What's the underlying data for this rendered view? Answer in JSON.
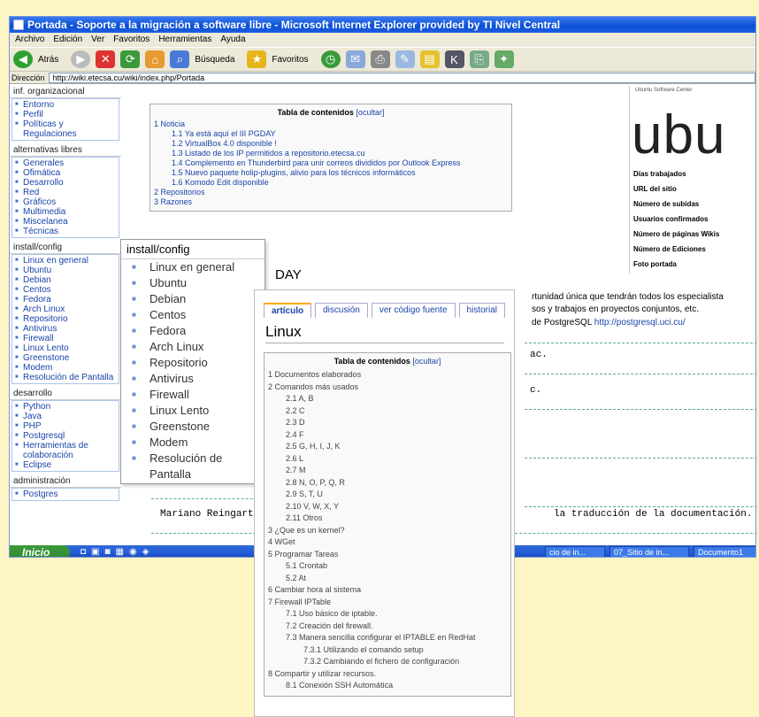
{
  "window": {
    "title": "Portada - Soporte a la migración a software libre - Microsoft Internet Explorer provided by TI Nivel Central"
  },
  "menu": [
    "Archivo",
    "Edición",
    "Ver",
    "Favoritos",
    "Herramientas",
    "Ayuda"
  ],
  "toolbar": {
    "back": "Atrás",
    "search": "Búsqueda",
    "favorites": "Favoritos"
  },
  "address": {
    "label": "Dirección",
    "url": "http://wiki.etecsa.cu/wiki/index.php/Portada"
  },
  "nav": [
    {
      "title": "inf. organizacional",
      "items": [
        "Entorno",
        "Perfil",
        "Políticas y Regulaciones"
      ]
    },
    {
      "title": "alternativas libres",
      "items": [
        "Generales",
        "Ofimática",
        "Desarrollo",
        "Red",
        "Gráficos",
        "Multimedia",
        "Miscelanea",
        "Técnicas"
      ]
    },
    {
      "title": "install/config",
      "items": [
        "Linux en general",
        "Ubuntu",
        "Debian",
        "Centos",
        "Fedora",
        "Arch Linux",
        "Repositorio",
        "Antivirus",
        "Firewall",
        "Linux Lento",
        "Greenstone",
        "Modem",
        "Resolución de Pantalla"
      ]
    },
    {
      "title": "desarrollo",
      "items": [
        "Python",
        "Java",
        "PHP",
        "Postgresql",
        "Herramientas de colaboración",
        "Eclipse"
      ]
    },
    {
      "title": "administración",
      "items": [
        "Postgres"
      ]
    }
  ],
  "toc1": {
    "title": "Tabla de contenidos",
    "toggle": "[ocultar]",
    "entries": [
      {
        "t": "1 Noticia",
        "l": 1
      },
      {
        "t": "1.1 Ya está aquí el III PGDAY",
        "l": 2
      },
      {
        "t": "1.2 VirtualBox 4.0 disponible !",
        "l": 2
      },
      {
        "t": "1.3 Listado de los IP permitidos a repositorio.etecsa.cu",
        "l": 2
      },
      {
        "t": "1.4 Complemento en Thunderbird para unir correos divididos por Outlook Express",
        "l": 2
      },
      {
        "t": "1.5 Nuevo paquete holip-plugins, alivio para los técnicos informáticos",
        "l": 2
      },
      {
        "t": "1.6 Komodo Edit disponible",
        "l": 2
      },
      {
        "t": "2 Repositorios",
        "l": 1
      },
      {
        "t": "3 Razones",
        "l": 1
      }
    ]
  },
  "right_panel": {
    "logo": "ubu",
    "badge": "Ubuntu Software Center",
    "items": [
      "Días trabajados",
      "URL del sitio",
      "Número de subidas",
      "Usuarios confirmados",
      "Número de páginas Wikis",
      "Número de Ediciones",
      "Foto portada"
    ]
  },
  "page_text": {
    "heading_fragment": "DAY",
    "para1": "rtunidad única que tendrán todos los especialista",
    "para2": "sos y trabajos en proyectos conjuntos, etc.",
    "para3": "de PostgreSQL",
    "link1": "http://postgresql.uci.cu/",
    "mono1": "ac.",
    "mono2": "c.",
    "mono_left": "Mariano Reingart",
    "mono_right": "la traducción de la documentación."
  },
  "popup": {
    "title": "install/config",
    "items": [
      "Linux en general",
      "Ubuntu",
      "Debian",
      "Centos",
      "Fedora",
      "Arch Linux",
      "Repositorio",
      "Antivirus",
      "Firewall",
      "Linux Lento",
      "Greenstone",
      "Modem",
      "Resolución de Pantalla"
    ]
  },
  "linux": {
    "tabs": [
      "artículo",
      "discusión",
      "ver código fuente",
      "historial"
    ],
    "title": "Linux",
    "toc_title": "Tabla de contenidos",
    "toc_toggle": "[ocultar]",
    "toc": [
      {
        "t": "1 Documentos elaborados",
        "l": 1
      },
      {
        "t": "2 Comandos más usados",
        "l": 1
      },
      {
        "t": "2.1 A, B",
        "l": 2
      },
      {
        "t": "2.2 C",
        "l": 2
      },
      {
        "t": "2.3 D",
        "l": 2
      },
      {
        "t": "2.4 F",
        "l": 2
      },
      {
        "t": "2.5 G, H, I, J, K",
        "l": 2
      },
      {
        "t": "2.6 L",
        "l": 2
      },
      {
        "t": "2.7 M",
        "l": 2
      },
      {
        "t": "2.8 N, O, P, Q, R",
        "l": 2
      },
      {
        "t": "2.9 S, T, U",
        "l": 2
      },
      {
        "t": "2.10 V, W, X, Y",
        "l": 2
      },
      {
        "t": "2.11 Otros",
        "l": 2
      },
      {
        "t": "3 ¿Que es un kernel?",
        "l": 1
      },
      {
        "t": "4 WGet",
        "l": 1
      },
      {
        "t": "5 Programar Tareas",
        "l": 1
      },
      {
        "t": "5.1 Crontab",
        "l": 2
      },
      {
        "t": "5.2 At",
        "l": 2
      },
      {
        "t": "6 Cambiar hora al sistema",
        "l": 1
      },
      {
        "t": "7 Firewall IPTable",
        "l": 1
      },
      {
        "t": "7.1 Uso básico de iptable.",
        "l": 2
      },
      {
        "t": "7.2 Creación del firewall.",
        "l": 2
      },
      {
        "t": "7.3 Manera sencilla configurar el IPTABLE en RedHat",
        "l": 2
      },
      {
        "t": "7.3.1 Utilizando el comando setup",
        "l": 3
      },
      {
        "t": "7.3.2 Cambiando el fichero de configuración",
        "l": 3
      },
      {
        "t": "8 Compartir y utilizar recursos.",
        "l": 1
      },
      {
        "t": "8.1 Conexión SSH Automática",
        "l": 2
      }
    ]
  },
  "taskbar": {
    "start": "Inicio",
    "tasks": [
      "cio de in...",
      "07_Sitio de in...",
      "Documento1"
    ]
  },
  "colors": {
    "background": "#fdf6c4",
    "title_blue": "#0a4fd4",
    "link": "#1a44a8",
    "start_green": "#2f8a2f"
  }
}
